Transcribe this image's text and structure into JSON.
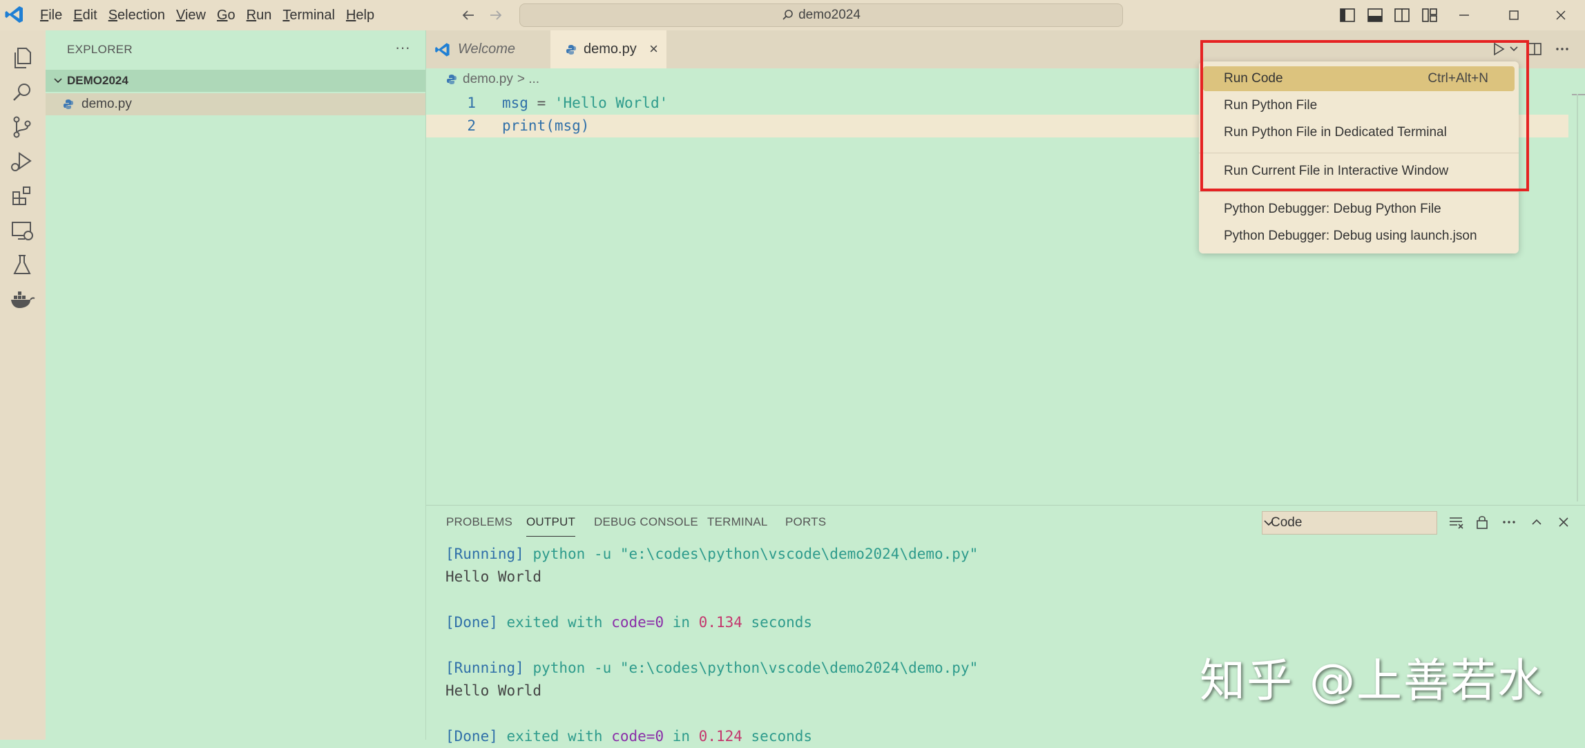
{
  "titlebar": {
    "menu": [
      "File",
      "Edit",
      "Selection",
      "View",
      "Go",
      "Run",
      "Terminal",
      "Help"
    ],
    "search_text": "demo2024"
  },
  "sidebar": {
    "title": "EXPLORER",
    "more": "···",
    "folder": "DEMO2024",
    "file": "demo.py"
  },
  "tabs": {
    "welcome": "Welcome",
    "demo": "demo.py",
    "close": "×"
  },
  "editor": {
    "breadcrumb_file": "demo.py",
    "breadcrumb_rest": "> ...",
    "lines": [
      {
        "num": "1"
      },
      {
        "num": "2"
      }
    ],
    "line1": {
      "var": "msg",
      "op": " = ",
      "str": "'Hello World'"
    },
    "line2": {
      "code": "print(msg)"
    }
  },
  "run_menu": {
    "items": [
      {
        "label": "Run Code",
        "shortcut": "Ctrl+Alt+N"
      },
      {
        "label": "Run Python File"
      },
      {
        "label": "Run Python File in Dedicated Terminal"
      },
      {
        "label": "Run Current File in Interactive Window"
      },
      {
        "label": "Python Debugger: Debug Python File"
      },
      {
        "label": "Python Debugger: Debug using launch.json"
      }
    ]
  },
  "panel": {
    "tabs": [
      "PROBLEMS",
      "OUTPUT",
      "DEBUG CONSOLE",
      "TERMINAL",
      "PORTS"
    ],
    "output_channel": "Code",
    "output": {
      "run1_tag": "[Running]",
      "run1_cmd": " python -u \"e:\\codes\\python\\vscode\\demo2024\\demo.py\"",
      "run1_result": "Hello World",
      "done1_tag": "[Done]",
      "done1_a": " exited with ",
      "done1_code": "code=0",
      "done1_b": " in ",
      "done1_time": "0.134",
      "done1_c": " seconds",
      "run2_tag": "[Running]",
      "run2_cmd": " python -u \"e:\\codes\\python\\vscode\\demo2024\\demo.py\"",
      "run2_result": "Hello World",
      "done2_tag": "[Done]",
      "done2_a": " exited with ",
      "done2_code": "code=0",
      "done2_b": " in ",
      "done2_time": "0.124",
      "done2_c": " seconds"
    }
  },
  "watermark": "知乎 @上善若水",
  "colors": {
    "editor_bg": "#c7eccf",
    "chrome_bg": "#e8dec8",
    "menu_highlight": "#dcc37e",
    "annotation_box": "#e52222",
    "vscode_blue": "#2f6fa8"
  }
}
